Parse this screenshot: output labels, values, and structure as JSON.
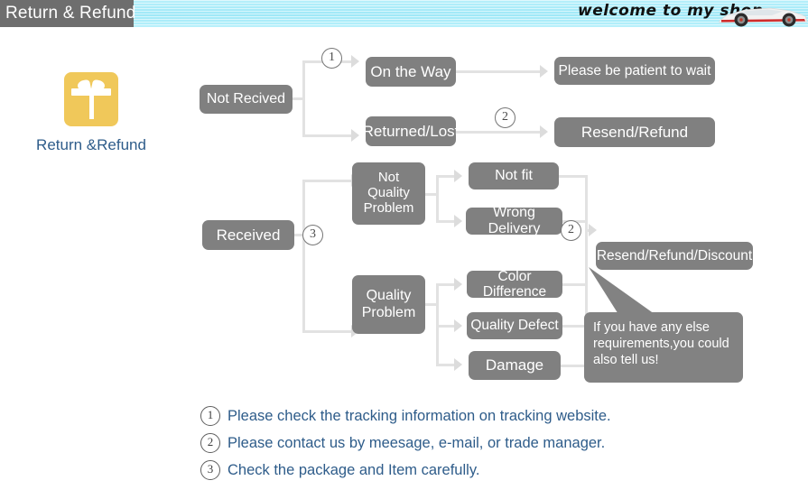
{
  "header": {
    "tab_label": "Return & Refund",
    "shop_banner_text": "welcome to my shop",
    "banner_color": "#a8ecf8",
    "tab_color": "#6e6e6e"
  },
  "sidebar": {
    "icon_name": "gift-box-icon",
    "icon_color": "#f0c85a",
    "label": "Return &Refund",
    "label_color": "#2e5c8a"
  },
  "flow": {
    "node_color": "#808080",
    "connector_color": "#e2e2e2",
    "nodes": {
      "not_received": "Not Recived",
      "on_the_way": "On the Way",
      "returned_lost": "Returned/Lost",
      "please_wait": "Please be patient to wait",
      "resend_refund": "Resend/Refund",
      "received": "Received",
      "not_quality_problem": "Not\nQuality\nProblem",
      "quality_problem": "Quality\nProblem",
      "not_fit": "Not fit",
      "wrong_delivery": "Wrong Delivery",
      "color_difference": "Color Difference",
      "quality_defect": "Quality Defect",
      "damage": "Damage",
      "resend_refund_discount": "Resend/Refund/Discount"
    },
    "markers": {
      "m1": "1",
      "m2_top": "2",
      "m3": "3",
      "m2_right": "2"
    },
    "bubble_text": "If you have any else\nrequirements,you could\nalso tell us!"
  },
  "legend": {
    "items": [
      {
        "num": "1",
        "text": "Please check the tracking information on tracking website."
      },
      {
        "num": "2",
        "text": "Please contact us by meesage, e-mail, or trade manager."
      },
      {
        "num": "3",
        "text": "Check the package and Item carefully."
      }
    ]
  }
}
